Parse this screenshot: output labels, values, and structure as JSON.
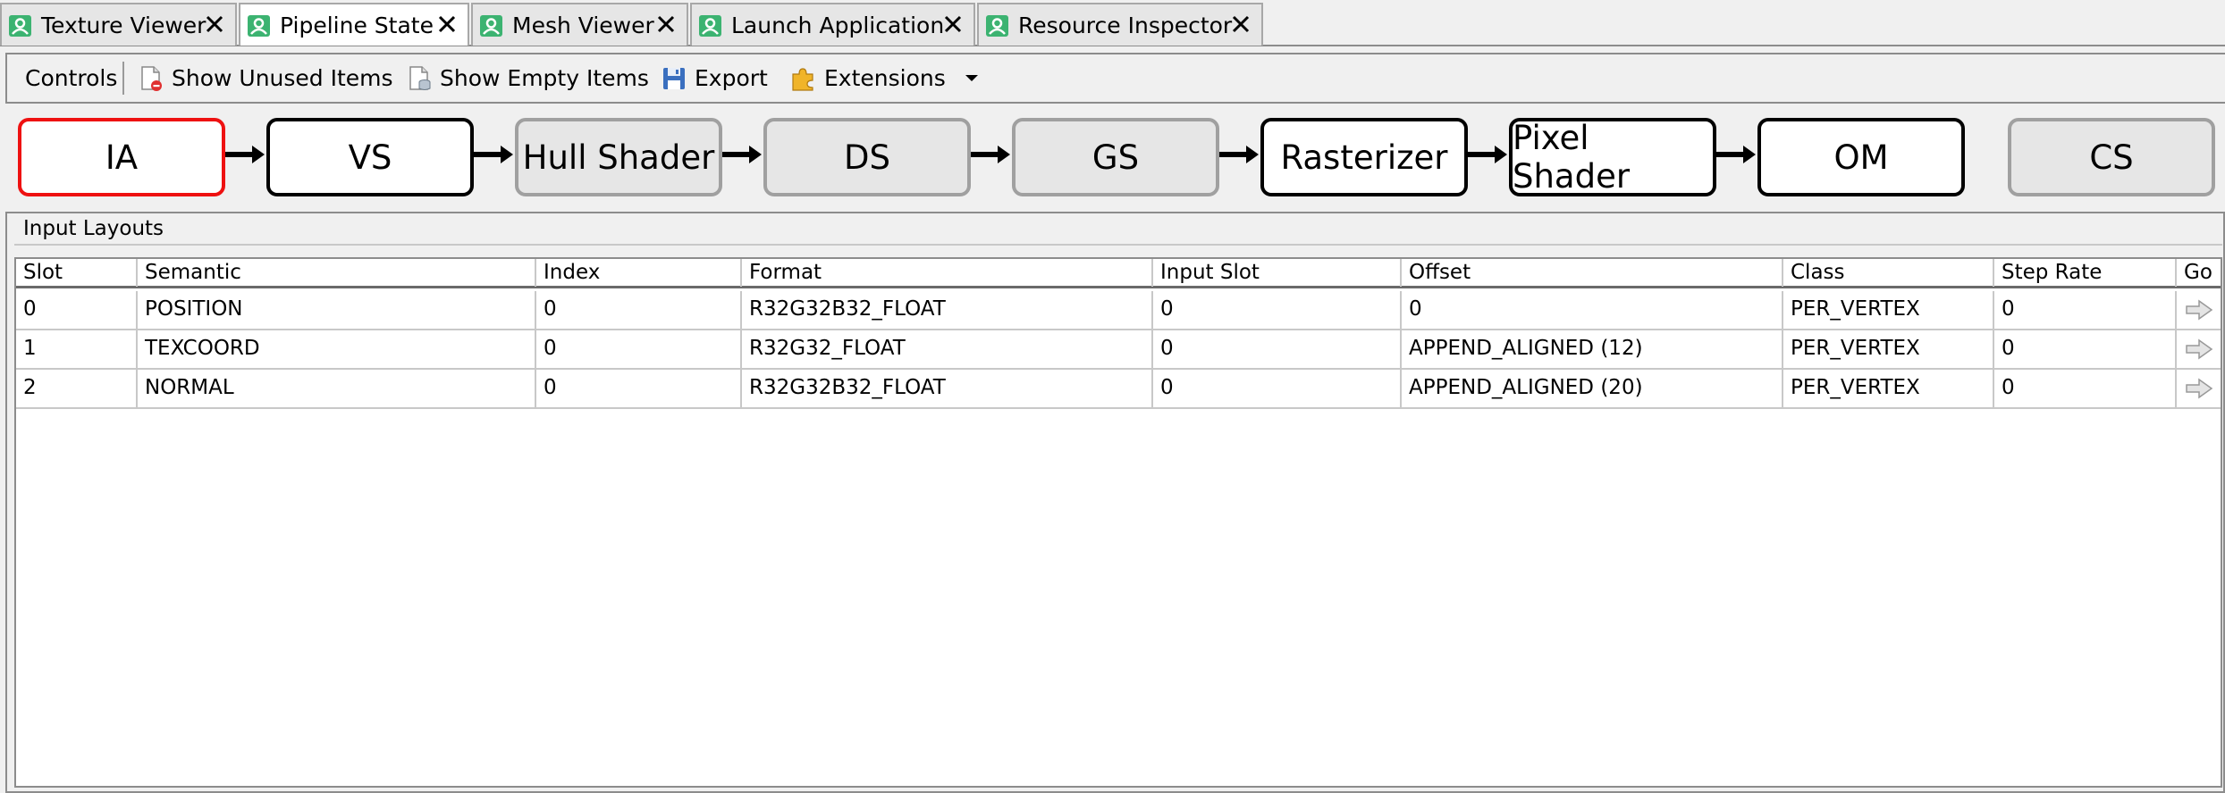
{
  "tabs": [
    {
      "label": "Texture Viewer",
      "icon": "person-icon"
    },
    {
      "label": "Pipeline State",
      "icon": "person-icon"
    },
    {
      "label": "Mesh Viewer",
      "icon": "person-icon"
    },
    {
      "label": "Launch Application",
      "icon": "person-icon"
    },
    {
      "label": "Resource Inspector",
      "icon": "person-icon"
    }
  ],
  "toolbar": {
    "controls_label": "Controls",
    "show_unused_label": "Show Unused Items",
    "show_empty_label": "Show Empty Items",
    "export_label": "Export",
    "extensions_label": "Extensions"
  },
  "pipeline": {
    "stages": [
      {
        "label": "IA",
        "state": "selected"
      },
      {
        "label": "VS",
        "state": "active"
      },
      {
        "label": "Hull Shader",
        "state": "inactive"
      },
      {
        "label": "DS",
        "state": "inactive"
      },
      {
        "label": "GS",
        "state": "inactive"
      },
      {
        "label": "Rasterizer",
        "state": "active"
      },
      {
        "label": "Pixel Shader",
        "state": "active"
      },
      {
        "label": "OM",
        "state": "active"
      },
      {
        "label": "CS",
        "state": "inactive"
      }
    ]
  },
  "input_layouts": {
    "title": "Input Layouts",
    "columns": [
      "Slot",
      "Semantic",
      "Index",
      "Format",
      "Input Slot",
      "Offset",
      "Class",
      "Step Rate",
      "Go"
    ],
    "rows": [
      [
        "0",
        "POSITION",
        "0",
        "R32G32B32_FLOAT",
        "0",
        "0",
        "PER_VERTEX",
        "0"
      ],
      [
        "1",
        "TEXCOORD",
        "0",
        "R32G32_FLOAT",
        "0",
        "APPEND_ALIGNED (12)",
        "PER_VERTEX",
        "0"
      ],
      [
        "2",
        "NORMAL",
        "0",
        "R32G32B32_FLOAT",
        "0",
        "APPEND_ALIGNED (20)",
        "PER_VERTEX",
        "0"
      ]
    ]
  },
  "colors": {
    "selected_stage_border": "#ee1111",
    "tab_icon": "#3cb371"
  }
}
